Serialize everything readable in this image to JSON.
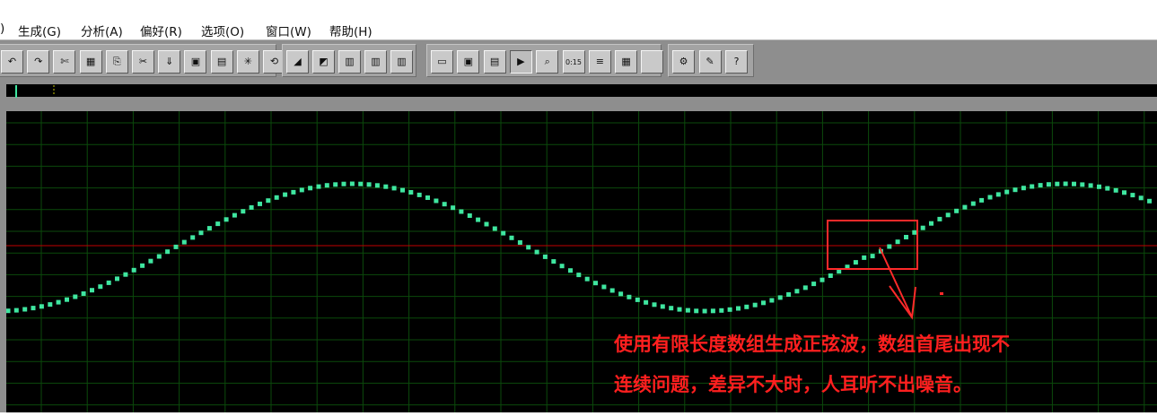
{
  "menu": {
    "items": [
      {
        "label": ")"
      },
      {
        "label": "生成(G)"
      },
      {
        "label": "分析(A)"
      },
      {
        "label": "偏好(R)"
      },
      {
        "label": "选项(O)"
      },
      {
        "label": "窗口(W)"
      },
      {
        "label": "帮助(H)"
      }
    ]
  },
  "toolbar": {
    "groups": [
      {
        "buttons": [
          {
            "icon": "undo-icon",
            "glyph": "↶"
          },
          {
            "icon": "redo-icon",
            "glyph": "↷"
          },
          {
            "icon": "scissors-wave-icon",
            "glyph": "✄"
          },
          {
            "icon": "grid-select-icon",
            "glyph": "▦"
          },
          {
            "icon": "copy-icon",
            "glyph": "⎘"
          },
          {
            "icon": "cut-icon",
            "glyph": "✂"
          },
          {
            "icon": "paste-icon",
            "glyph": "⇓"
          },
          {
            "icon": "mix-paste-icon",
            "glyph": "▣"
          },
          {
            "icon": "paste-new-icon",
            "glyph": "▤"
          },
          {
            "icon": "trim-icon",
            "glyph": "✳"
          },
          {
            "icon": "loop-icon",
            "glyph": "⟲"
          }
        ]
      },
      {
        "buttons": [
          {
            "icon": "envelope-icon",
            "glyph": "◢"
          },
          {
            "icon": "mark-icon",
            "glyph": "◩"
          },
          {
            "icon": "multi-track-1-icon",
            "glyph": "▥"
          },
          {
            "icon": "multi-track-2-icon",
            "glyph": "▥"
          },
          {
            "icon": "multi-track-3-icon",
            "glyph": "▥"
          }
        ]
      },
      {
        "buttons": [
          {
            "icon": "waveform-view-icon",
            "glyph": "▭"
          },
          {
            "icon": "spectral-view-icon",
            "glyph": "▣"
          },
          {
            "icon": "cue-list-icon",
            "glyph": "▤"
          },
          {
            "icon": "play-icon",
            "glyph": "▶"
          },
          {
            "icon": "zoom-icon",
            "glyph": "⌕"
          },
          {
            "icon": "time-display-icon",
            "glyph": "0:15"
          },
          {
            "icon": "info-icon",
            "glyph": "≡"
          },
          {
            "icon": "color-bars-icon",
            "glyph": "▦"
          },
          {
            "icon": "blank-icon",
            "glyph": ""
          }
        ]
      },
      {
        "buttons": [
          {
            "icon": "settings-icon",
            "glyph": "⚙"
          },
          {
            "icon": "script-icon",
            "glyph": "✎"
          },
          {
            "icon": "help-icon",
            "glyph": "?"
          }
        ]
      }
    ]
  },
  "colors": {
    "wave": "#3fe6a0",
    "grid": "#0b4a0b",
    "center_line": "#c00000",
    "highlight_box": "#ff2a2a",
    "annotation_text": "#ff1f1f",
    "overview_cursor": "#3fe6a0"
  },
  "annotation": {
    "line1": "使用有限长度数组生成正弦波，数组首尾出现不",
    "line2": "连续问题，差异不大时，人耳听不出噪音。"
  }
}
